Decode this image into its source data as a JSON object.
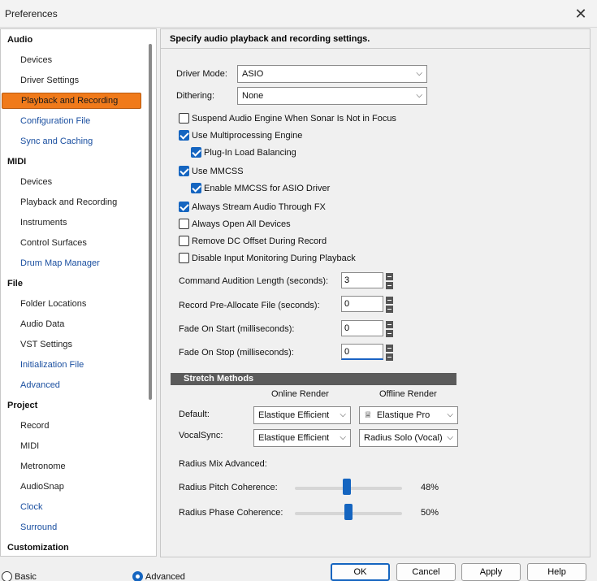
{
  "window": {
    "title": "Preferences"
  },
  "nav": {
    "audio": {
      "label": "Audio",
      "items": [
        "Devices",
        "Driver Settings",
        "Playback and Recording",
        "Configuration File",
        "Sync and Caching"
      ]
    },
    "midi": {
      "label": "MIDI",
      "items": [
        "Devices",
        "Playback and Recording",
        "Instruments",
        "Control Surfaces",
        "Drum Map Manager"
      ]
    },
    "file": {
      "label": "File",
      "items": [
        "Folder Locations",
        "Audio Data",
        "VST Settings",
        "Initialization File",
        "Advanced"
      ]
    },
    "project": {
      "label": "Project",
      "items": [
        "Record",
        "MIDI",
        "Metronome",
        "AudioSnap",
        "Clock",
        "Surround"
      ]
    },
    "customization": {
      "label": "Customization"
    },
    "selected": "Playback and Recording"
  },
  "panel": {
    "heading": "Specify audio playback and recording settings.",
    "driver_mode": {
      "label": "Driver Mode:",
      "value": "ASIO"
    },
    "dithering": {
      "label": "Dithering:",
      "value": "None"
    },
    "checkboxes": [
      {
        "label": "Suspend Audio Engine When Sonar Is Not in Focus",
        "checked": false
      },
      {
        "label": "Use Multiprocessing Engine",
        "checked": true
      },
      {
        "label": "Plug-In Load Balancing",
        "checked": true
      },
      {
        "label": "Use MMCSS",
        "checked": true
      },
      {
        "label": "Enable MMCSS for ASIO Driver",
        "checked": true
      },
      {
        "label": "Always Stream Audio Through FX",
        "checked": true
      },
      {
        "label": "Always Open All Devices",
        "checked": false
      },
      {
        "label": "Remove DC Offset During Record",
        "checked": false
      },
      {
        "label": "Disable Input Monitoring During Playback",
        "checked": false
      }
    ],
    "fields": [
      {
        "label": "Command Audition Length (seconds):",
        "value": "3"
      },
      {
        "label": "Record Pre-Allocate File (seconds):",
        "value": "0"
      },
      {
        "label": "Fade On Start  (milliseconds):",
        "value": "0"
      },
      {
        "label": "Fade On Stop  (milliseconds):",
        "value": "0"
      }
    ],
    "stretch": {
      "title": "Stretch Methods",
      "online_header": "Online Render",
      "offline_header": "Offline Render",
      "default_label": "Default:",
      "default_online": "Elastique Efficient",
      "default_offline": "Elastique Pro",
      "vocalsync_label": "VocalSync:",
      "vocalsync_online": "Elastique Efficient",
      "vocalsync_offline": "Radius Solo (Vocal)"
    },
    "radius": {
      "mix_label": "Radius Mix Advanced:",
      "pitch_label": "Radius Pitch Coherence:",
      "pitch_value": "48%",
      "phase_label": "Radius Phase Coherence:",
      "phase_value": "50%"
    }
  },
  "footer": {
    "basic_label": "Basic",
    "advanced_label": "Advanced",
    "mode_selected": "Advanced",
    "ok": "OK",
    "cancel": "Cancel",
    "apply": "Apply",
    "help": "Help"
  },
  "colors": {
    "accent": "#1565c0",
    "selected_nav": "#f07a1a",
    "section_bar": "#5b5b5b"
  }
}
